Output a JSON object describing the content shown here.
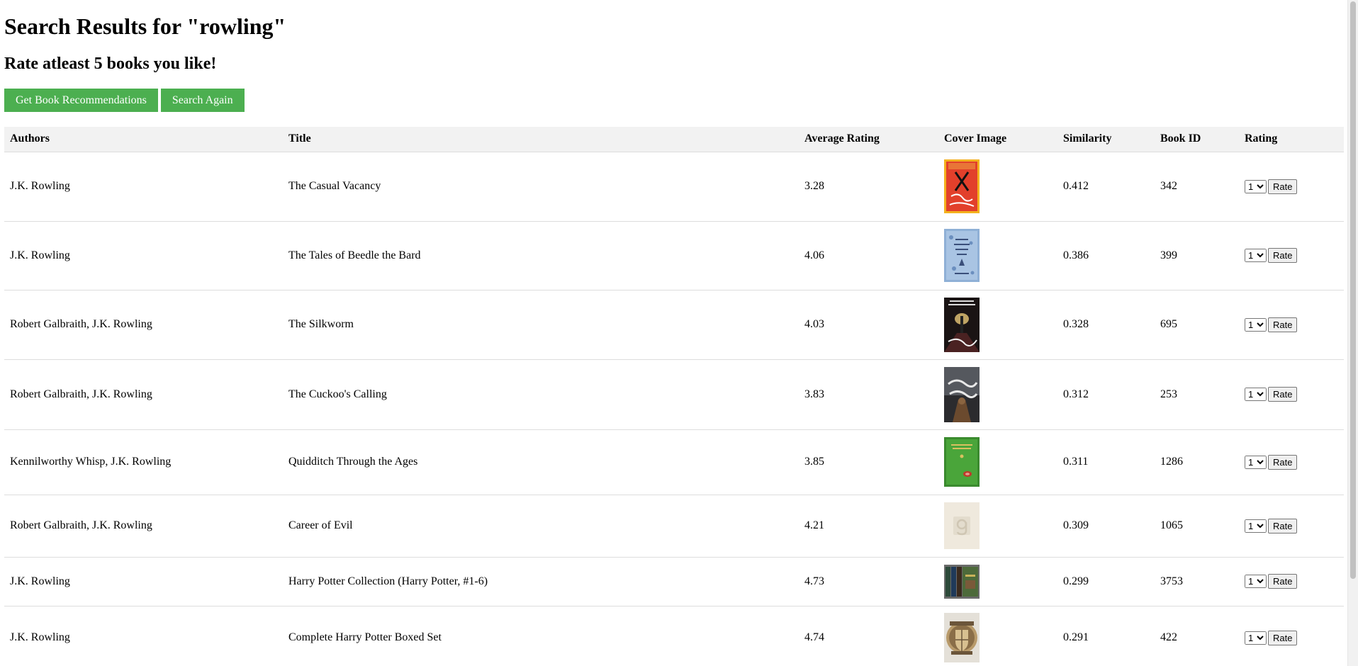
{
  "page": {
    "heading": "Search Results for \"rowling\"",
    "subheading": "Rate atleast 5 books you like!",
    "buttons": {
      "recommend_label": "Get Book Recommendations",
      "search_again_label": "Search Again"
    }
  },
  "table": {
    "headers": [
      "Authors",
      "Title",
      "Average Rating",
      "Cover Image",
      "Similarity",
      "Book ID",
      "Rating"
    ],
    "rows": [
      {
        "authors": "J.K. Rowling",
        "title": "The Casual Vacancy",
        "avg_rating": "3.28",
        "similarity": "0.412",
        "book_id": "342",
        "rating": "1",
        "rate_label": "Rate",
        "cover": "casual-vacancy-cover-image"
      },
      {
        "authors": "J.K. Rowling",
        "title": "The Tales of Beedle the Bard",
        "avg_rating": "4.06",
        "similarity": "0.386",
        "book_id": "399",
        "rating": "1",
        "rate_label": "Rate",
        "cover": "beedle-the-bard-cover-image"
      },
      {
        "authors": "Robert Galbraith, J.K. Rowling",
        "title": "The Silkworm",
        "avg_rating": "4.03",
        "similarity": "0.328",
        "book_id": "695",
        "rating": "1",
        "rate_label": "Rate",
        "cover": "silkworm-cover-image"
      },
      {
        "authors": "Robert Galbraith, J.K. Rowling",
        "title": "The Cuckoo's Calling",
        "avg_rating": "3.83",
        "similarity": "0.312",
        "book_id": "253",
        "rating": "1",
        "rate_label": "Rate",
        "cover": "cuckoos-calling-cover-image"
      },
      {
        "authors": "Kennilworthy Whisp, J.K. Rowling",
        "title": "Quidditch Through the Ages",
        "avg_rating": "3.85",
        "similarity": "0.311",
        "book_id": "1286",
        "rating": "1",
        "rate_label": "Rate",
        "cover": "quidditch-cover-image"
      },
      {
        "authors": "Robert Galbraith, J.K. Rowling",
        "title": "Career of Evil",
        "avg_rating": "4.21",
        "similarity": "0.309",
        "book_id": "1065",
        "rating": "1",
        "rate_label": "Rate",
        "cover": "placeholder-cover-image"
      },
      {
        "authors": "J.K. Rowling",
        "title": "Harry Potter Collection (Harry Potter, #1-6)",
        "avg_rating": "4.73",
        "similarity": "0.299",
        "book_id": "3753",
        "rating": "1",
        "rate_label": "Rate",
        "cover": "hp-collection-cover-image"
      },
      {
        "authors": "J.K. Rowling",
        "title": "Complete Harry Potter Boxed Set",
        "avg_rating": "4.74",
        "similarity": "0.291",
        "book_id": "422",
        "rating": "1",
        "rate_label": "Rate",
        "cover": "hogwarts-crest-cover-image"
      }
    ]
  }
}
